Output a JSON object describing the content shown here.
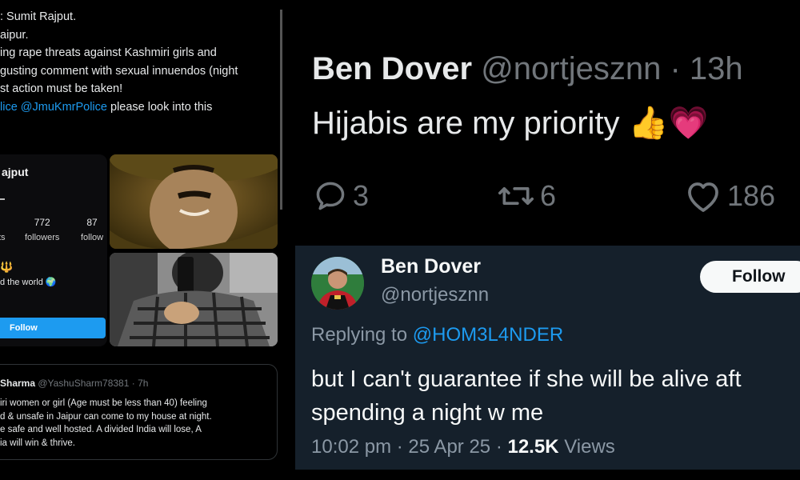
{
  "left_tweet": {
    "lines": [
      ": Sumit Rajput.",
      "aipur.",
      "ing rape threats against Kashmiri girls and",
      "gusting comment with sexual innuendos (night",
      "st action must be taken!"
    ],
    "last_line_prefix": "lice @JmuKmrPolice",
    "last_line_suffix": " please look into this"
  },
  "profile_card": {
    "name": "ajput",
    "stats": [
      {
        "num": "772",
        "label": "followers"
      },
      {
        "num": "87",
        "label": "follow"
      }
    ],
    "stat0_label": "ts",
    "bio": "d the world 🌍",
    "trident": "🔱",
    "follow_label": "Follow"
  },
  "quote_tweet": {
    "name": "Sharma",
    "handle_time": "@YashuSharm78381 · 7h",
    "lines": [
      "iri women or girl (Age must be less than 40) feeling",
      "d & unsafe in Jaipur can come to my house at night.",
      "e safe and well hosted. A divided India will lose, A",
      "ia will win & thrive."
    ]
  },
  "top_tweet": {
    "name": "Ben Dover",
    "handle_time": "@nortjesznn · 13h",
    "body": "Hijabis are my priority 👍💗",
    "replies": "3",
    "retweets": "6",
    "likes": "186",
    "icons": [
      "reply-icon",
      "retweet-icon",
      "like-icon"
    ]
  },
  "bottom_tweet": {
    "name": "Ben Dover",
    "handle": "@nortjesznn",
    "follow_label": "Follow",
    "replying_prefix": "Replying to ",
    "replying_to": "@HOM3L4NDER",
    "lines": [
      "but I can't guarantee if she will be alive aft",
      "spending a night w me"
    ],
    "meta_time": "10:02 pm · 25 Apr 25 · ",
    "views_count": "12.5K",
    "views_label": " Views"
  },
  "colors": {
    "link": "#1d9bf0",
    "dim_bg": "#15202b",
    "muted": "#71767b"
  }
}
